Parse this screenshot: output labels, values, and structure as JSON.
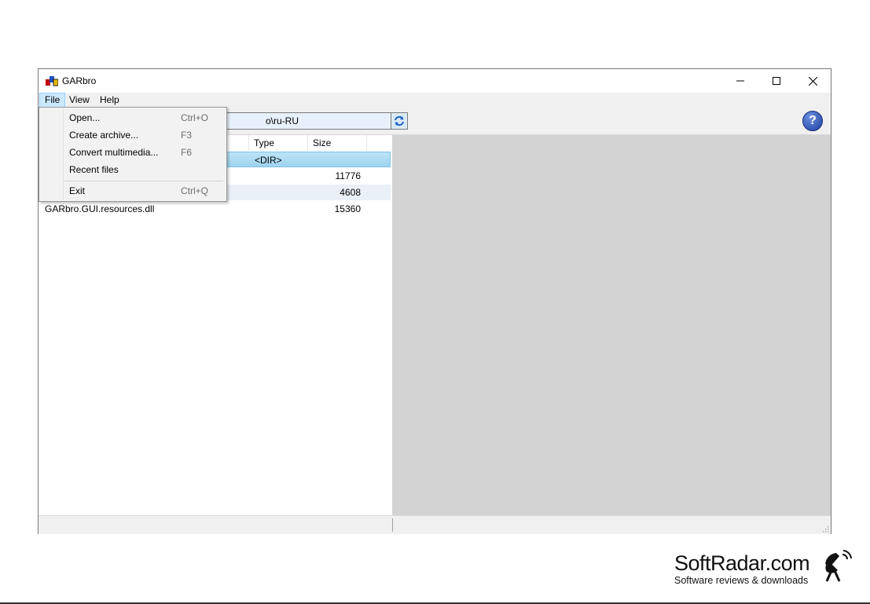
{
  "window": {
    "title": "GARbro"
  },
  "menubar": {
    "file": "File",
    "view": "View",
    "help": "Help"
  },
  "toolbar": {
    "path_visible": "o\\ru-RU",
    "help_glyph": "?"
  },
  "file_list": {
    "columns": {
      "type": "Type",
      "size": "Size"
    },
    "rows": [
      {
        "name": "",
        "type": "<DIR>",
        "size": ""
      },
      {
        "name": "",
        "type": "",
        "size": "11776"
      },
      {
        "name": "",
        "type": "",
        "size": "4608"
      },
      {
        "name": "GARbro.GUI.resources.dll",
        "type": "",
        "size": "15360"
      }
    ]
  },
  "file_menu": {
    "items": [
      {
        "label": "Open...",
        "shortcut": "Ctrl+O"
      },
      {
        "label": "Create archive...",
        "shortcut": "F3"
      },
      {
        "label": "Convert multimedia...",
        "shortcut": "F6"
      },
      {
        "label": "Recent files",
        "shortcut": ""
      },
      {
        "label": "Exit",
        "shortcut": "Ctrl+Q"
      }
    ]
  },
  "watermark": {
    "main": "SoftRadar.com",
    "sub": "Software reviews & downloads"
  },
  "colors": {
    "selection": "#bde3f7",
    "preview_bg": "#d3d3d3",
    "menu_active": "#cce8ff"
  }
}
